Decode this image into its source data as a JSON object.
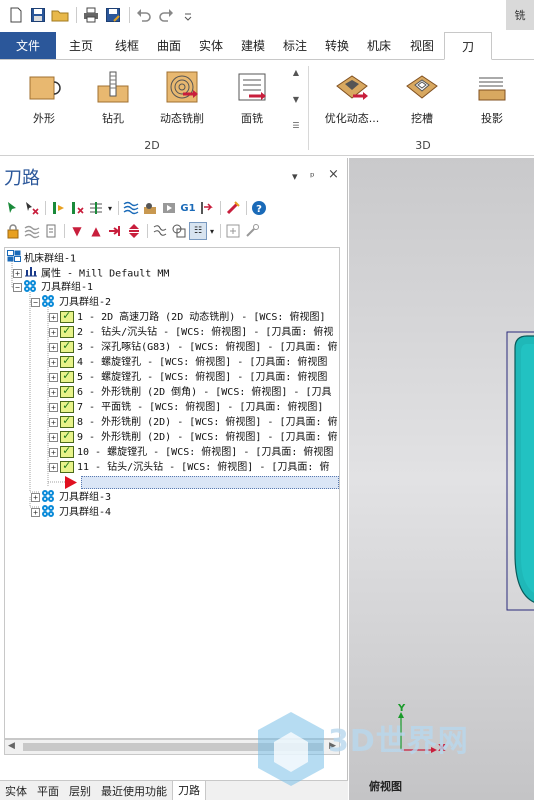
{
  "quick_access": {
    "icons": [
      "new-file-icon",
      "save-icon",
      "open-folder-icon",
      "print-icon",
      "save-as-icon",
      "undo-icon",
      "redo-icon",
      "customize-icon"
    ],
    "context_tab_label": "铣"
  },
  "ribbon_tabs": [
    {
      "label": "文件"
    },
    {
      "label": "主页"
    },
    {
      "label": "线框"
    },
    {
      "label": "曲面"
    },
    {
      "label": "实体"
    },
    {
      "label": "建模"
    },
    {
      "label": "标注"
    },
    {
      "label": "转换"
    },
    {
      "label": "机床"
    },
    {
      "label": "视图"
    },
    {
      "label": "刀"
    }
  ],
  "ribbon": {
    "group_2d": {
      "label": "2D",
      "buttons": [
        {
          "label": "外形",
          "icon": "contour-icon"
        },
        {
          "label": "钻孔",
          "icon": "drill-icon"
        },
        {
          "label": "动态铣削",
          "icon": "dynamic-mill-icon"
        },
        {
          "label": "面铣",
          "icon": "face-mill-icon"
        }
      ]
    },
    "group_3d": {
      "label": "3D",
      "buttons": [
        {
          "label": "优化动态...",
          "icon": "optirough-icon"
        },
        {
          "label": "挖槽",
          "icon": "pocket-icon"
        },
        {
          "label": "投影",
          "icon": "project-icon"
        }
      ]
    }
  },
  "panel": {
    "title": "刀路",
    "controls": {
      "dropdown": "▾",
      "pin": "ᵖ",
      "close": "×"
    }
  },
  "tree": {
    "machine_group": "机床群组-1",
    "properties": "属性 - Mill Default MM",
    "toolpath_group": "刀具群组-1",
    "subgroup": "刀具群组-2",
    "operations": [
      "1 - 2D 高速刀路 (2D 动态铣削) - [WCS: 俯视图]",
      "2 - 钻头/沉头钻 - [WCS: 俯视图] - [刀具面: 俯视",
      "3 - 深孔啄钻(G83) - [WCS: 俯视图] - [刀具面: 俯",
      "4 - 螺旋镗孔 - [WCS: 俯视图] - [刀具面: 俯视图",
      "5 - 螺旋镗孔 - [WCS: 俯视图] - [刀具面: 俯视图",
      "6 - 外形铣削 (2D 倒角) - [WCS: 俯视图] - [刀具",
      "7 - 平面铣 - [WCS: 俯视图] - [刀具面: 俯视图]",
      "8 - 外形铣削 (2D) - [WCS: 俯视图] - [刀具面: 俯",
      "9 - 外形铣削 (2D) - [WCS: 俯视图] - [刀具面: 俯",
      "10 - 螺旋镗孔 - [WCS: 俯视图] - [刀具面: 俯视图",
      "11 - 钻头/沉头钻 - [WCS: 俯视图] - [刀具面: 俯"
    ],
    "other_groups": [
      "刀具群组-3",
      "刀具群组-4"
    ]
  },
  "bottom_tabs": [
    {
      "label": "实体"
    },
    {
      "label": "平面"
    },
    {
      "label": "层别"
    },
    {
      "label": "最近使用功能"
    },
    {
      "label": "刀路"
    }
  ],
  "viewport": {
    "view_label": "俯视图",
    "axis_x": "X",
    "axis_y": "Y",
    "watermark": "3D世界网",
    "colors": {
      "part": "#1fb8b8",
      "part_outline": "#2a2a7a"
    }
  },
  "colors": {
    "accent": "#2b579a",
    "file_tab": "#2b579a"
  }
}
